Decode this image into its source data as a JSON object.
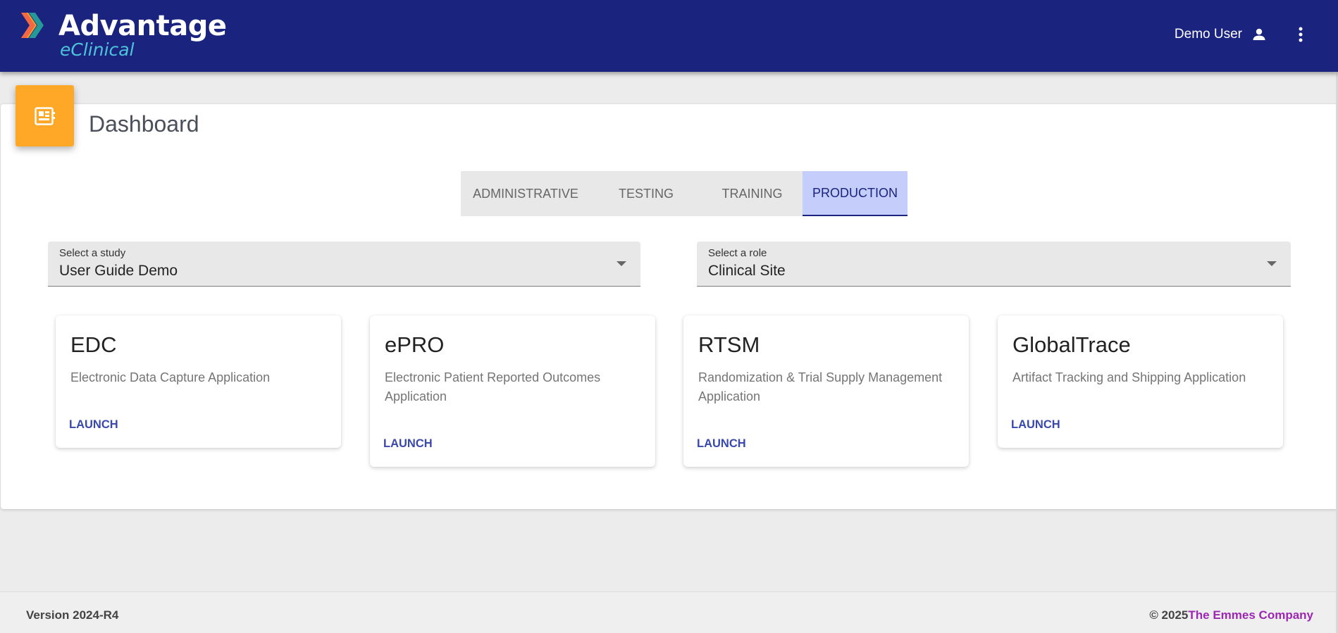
{
  "header": {
    "brand_name": "Advantage",
    "brand_sub": "eClinical",
    "user_name": "Demo User",
    "user_icon": "person-icon",
    "menu_icon": "more-vert-icon",
    "bg_color": "#1a237e"
  },
  "page": {
    "title": "Dashboard",
    "icon": "dashboard-icon",
    "icon_color": "#ffa726"
  },
  "tabs": [
    {
      "label": "Administrative",
      "active": false
    },
    {
      "label": "Testing",
      "active": false
    },
    {
      "label": "Training",
      "active": false
    },
    {
      "label": "Production",
      "active": true
    }
  ],
  "study_select": {
    "label": "Select a study",
    "value": "User Guide Demo"
  },
  "role_select": {
    "label": "Select a role",
    "value": "Clinical Site"
  },
  "apps": [
    {
      "title": "EDC",
      "description": "Electronic Data Capture Application",
      "action": "Launch"
    },
    {
      "title": "ePRO",
      "description": "Electronic Patient Reported Outcomes Application",
      "action": "Launch"
    },
    {
      "title": "RTSM",
      "description": "Randomization & Trial Supply Management Application",
      "action": "Launch"
    },
    {
      "title": "GlobalTrace",
      "description": "Artifact Tracking and Shipping Application",
      "action": "Launch"
    }
  ],
  "footer": {
    "version": "Version 2024-R4",
    "copyright_prefix": "© 2025",
    "company": "The Emmes Company"
  }
}
